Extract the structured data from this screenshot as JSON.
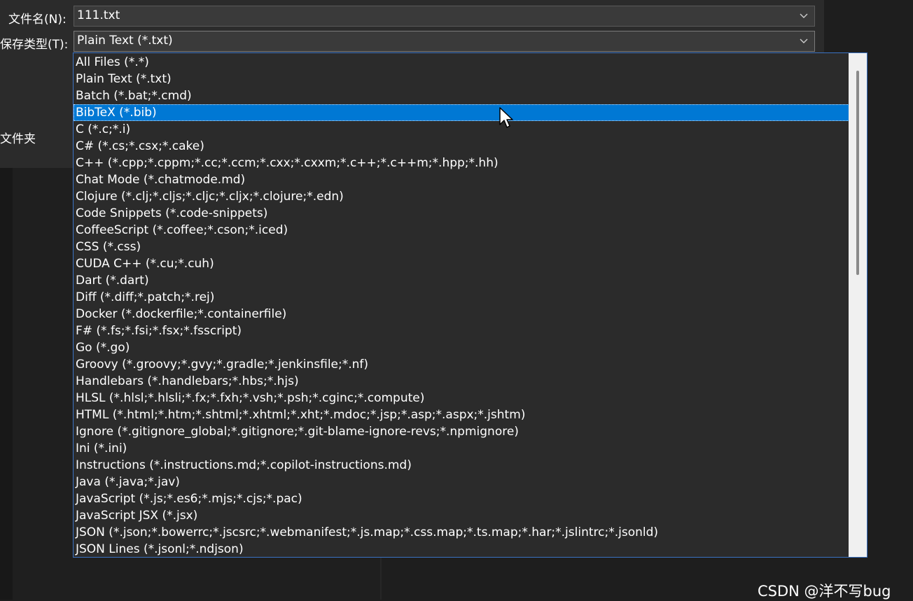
{
  "dialog": {
    "filename_label": "文件名(N):",
    "filename_value": "111.txt",
    "filetype_label": "保存类型(T):",
    "filetype_value": "Plain Text (*.txt)",
    "folder_label": "文件夹"
  },
  "dropdown": {
    "selected_index": 3,
    "items": [
      "All Files (*.*)",
      "Plain Text (*.txt)",
      "Batch (*.bat;*.cmd)",
      "BibTeX (*.bib)",
      "C (*.c;*.i)",
      "C# (*.cs;*.csx;*.cake)",
      "C++ (*.cpp;*.cppm;*.cc;*.ccm;*.cxx;*.cxxm;*.c++;*.c++m;*.hpp;*.hh)",
      "Chat Mode (*.chatmode.md)",
      "Clojure (*.clj;*.cljs;*.cljc;*.cljx;*.clojure;*.edn)",
      "Code Snippets (*.code-snippets)",
      "CoffeeScript (*.coffee;*.cson;*.iced)",
      "CSS (*.css)",
      "CUDA C++ (*.cu;*.cuh)",
      "Dart (*.dart)",
      "Diff (*.diff;*.patch;*.rej)",
      "Docker (*.dockerfile;*.containerfile)",
      "F# (*.fs;*.fsi;*.fsx;*.fsscript)",
      "Go (*.go)",
      "Groovy (*.groovy;*.gvy;*.gradle;*.jenkinsfile;*.nf)",
      "Handlebars (*.handlebars;*.hbs;*.hjs)",
      "HLSL (*.hlsl;*.hlsli;*.fx;*.fxh;*.vsh;*.psh;*.cginc;*.compute)",
      "HTML (*.html;*.htm;*.shtml;*.xhtml;*.xht;*.mdoc;*.jsp;*.asp;*.aspx;*.jshtm)",
      "Ignore (*.gitignore_global;*.gitignore;*.git-blame-ignore-revs;*.npmignore)",
      "Ini (*.ini)",
      "Instructions (*.instructions.md;*.copilot-instructions.md)",
      "Java (*.java;*.jav)",
      "JavaScript (*.js;*.es6;*.mjs;*.cjs;*.pac)",
      "JavaScript JSX (*.jsx)",
      "JSON (*.json;*.bowerrc;*.jscsrc;*.webmanifest;*.js.map;*.css.map;*.ts.map;*.har;*.jslintrc;*.jsonld)",
      "JSON Lines (*.jsonl;*.ndjson)"
    ]
  },
  "watermark": "CSDN @洋不写bug",
  "icons": {
    "combo_arrow": "chevron-down-icon",
    "pointer": "mouse-cursor-icon"
  },
  "colors": {
    "selection": "#0078d4",
    "list_background": "#2b2b2b",
    "list_border": "#3b73c4"
  }
}
